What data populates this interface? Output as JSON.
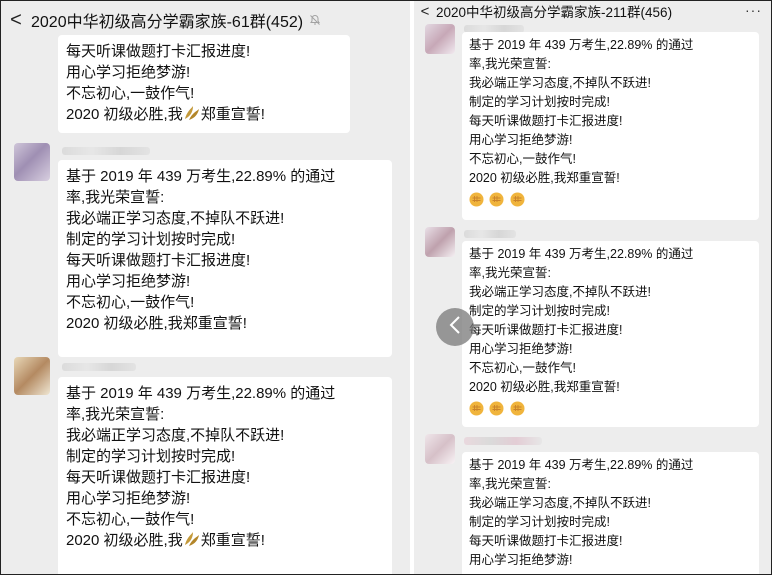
{
  "left": {
    "title": "2020中华初级高分学霸家族-61群(452)",
    "back_label": "<",
    "messages": [
      {
        "lines": [
          "每天听课做题打卡汇报进度!",
          "用心学习拒绝梦游!",
          "不忘初心,一鼓作气!"
        ],
        "last_before": "2020 初级必胜,我",
        "last_after": "郑重宣誓!",
        "has_leaf": true
      },
      {
        "lines": [
          "基于 2019 年 439 万考生,22.89% 的通过",
          "率,我光荣宣誓:",
          "我必端正学习态度,不掉队不跃进!",
          "制定的学习计划按时完成!",
          "每天听课做题打卡汇报进度!",
          "用心学习拒绝梦游!",
          "不忘初心,一鼓作气!",
          "2020 初级必胜,我郑重宣誓!"
        ]
      },
      {
        "lines": [
          "基于 2019 年 439 万考生,22.89% 的通过",
          "率,我光荣宣誓:",
          "我必端正学习态度,不掉队不跃进!",
          "制定的学习计划按时完成!",
          "每天听课做题打卡汇报进度!",
          "用心学习拒绝梦游!",
          "不忘初心,一鼓作气!"
        ],
        "last_before": "2020 初级必胜,我",
        "last_after": "郑重宣誓!",
        "has_leaf": true
      }
    ]
  },
  "right": {
    "title": "2020中华初级高分学霸家族-211群(456)",
    "back_label": "<",
    "more_label": "···",
    "messages": [
      {
        "lines": [
          "基于 2019 年 439 万考生,22.89% 的通过",
          "率,我光荣宣誓:",
          "我必端正学习态度,不掉队不跃进!",
          "制定的学习计划按时完成!",
          "每天听课做题打卡汇报进度!",
          "用心学习拒绝梦游!",
          "不忘初心,一鼓作气!",
          "2020 初级必胜,我郑重宣誓!"
        ],
        "emoji": "fist-emoji x3"
      },
      {
        "lines": [
          "基于 2019 年 439 万考生,22.89% 的通过",
          "率,我光荣宣誓:",
          "我必端正学习态度,不掉队不跃进!",
          "制定的学习计划按时完成!",
          "每天听课做题打卡汇报进度!",
          "用心学习拒绝梦游!",
          "不忘初心,一鼓作气!",
          "2020 初级必胜,我郑重宣誓!"
        ],
        "emoji": "fist-emoji x3"
      },
      {
        "lines": [
          "基于 2019 年 439 万考生,22.89% 的通过",
          "率,我光荣宣誓:",
          "我必端正学习态度,不掉队不跃进!",
          "制定的学习计划按时完成!",
          "每天听课做题打卡汇报进度!",
          "用心学习拒绝梦游!"
        ]
      }
    ]
  },
  "nav": {
    "icon": "chevron-left-icon",
    "color": "#8a8a8a"
  }
}
